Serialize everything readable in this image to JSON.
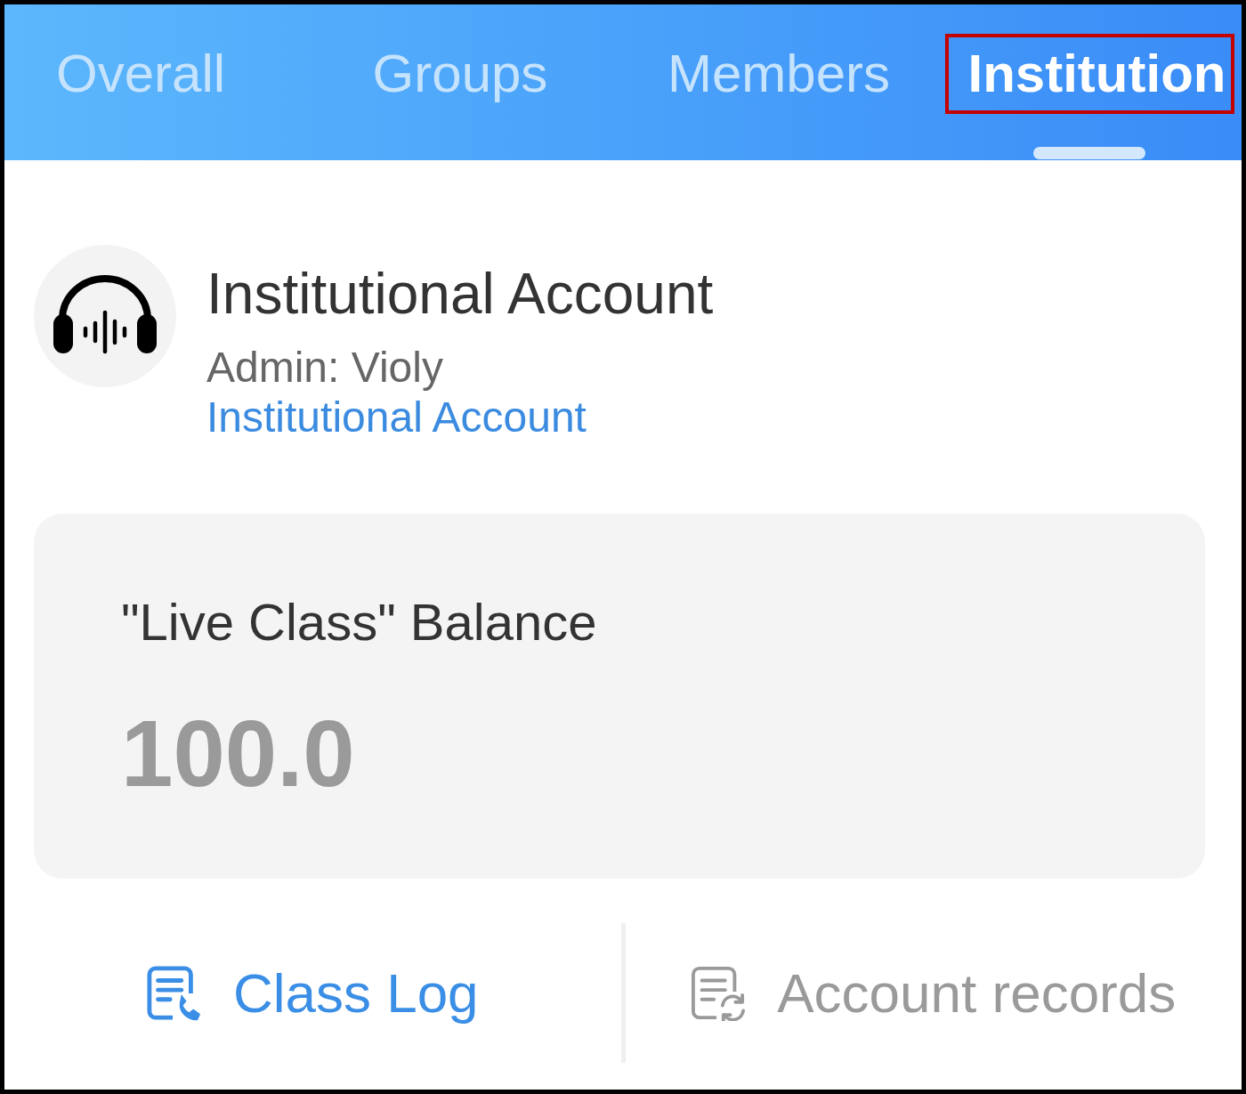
{
  "tabs": [
    {
      "label": "Overall",
      "selected": false,
      "highlighted": false
    },
    {
      "label": "Groups",
      "selected": false,
      "highlighted": false
    },
    {
      "label": "Members",
      "selected": false,
      "highlighted": false
    },
    {
      "label": "Institution",
      "selected": true,
      "highlighted": true
    }
  ],
  "account": {
    "title": "Institutional Account",
    "admin": "Admin: Violy",
    "type_link": "Institutional Account"
  },
  "balance_card": {
    "label": "\"Live Class\" Balance",
    "value": "100.0"
  },
  "actions": [
    {
      "kind": "log",
      "label": "Class Log",
      "selected": true
    },
    {
      "kind": "records",
      "label": "Account records",
      "selected": false
    }
  ]
}
